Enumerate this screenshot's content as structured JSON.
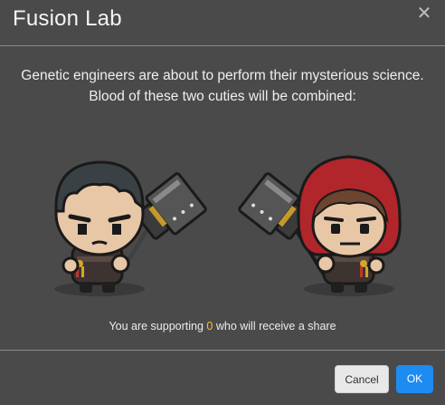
{
  "dialog": {
    "title": "Fusion Lab",
    "close_icon": "close-icon",
    "intro_line1": "Genetic engineers are about to perform their mysterious science.",
    "intro_line2": "Blood of these two cuties will be combined:",
    "support_prefix": "You are supporting",
    "support_count": "0",
    "support_suffix": "who will receive a share",
    "cancel_label": "Cancel",
    "ok_label": "OK"
  },
  "characters": [
    {
      "name": "warrior-with-hammer",
      "hair": "#2f3538",
      "accent": "#d4a62a"
    },
    {
      "name": "red-hood-warrior-with-hammer",
      "hair": "#b0262a",
      "accent": "#d4a62a"
    }
  ],
  "colors": {
    "background": "#4a4a4a",
    "ok_button": "#1e8bf1",
    "cancel_button": "#e8e8e8",
    "highlight": "#f0c330"
  }
}
